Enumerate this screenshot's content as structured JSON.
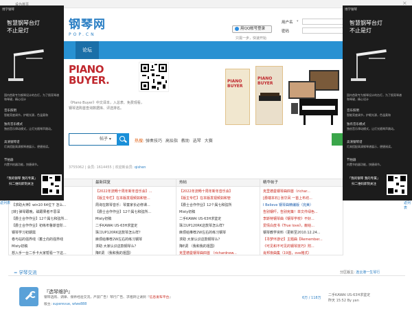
{
  "topbar": {
    "text": "设为首页"
  },
  "logo": {
    "main": "钢琴网",
    "domain": "POP.CN"
  },
  "login": {
    "qq_button": "用QQ帐号登录",
    "hint": "只需一步，快速开始",
    "user_label": "用户名",
    "pass_label": "密码"
  },
  "nav": {
    "active": "论坛"
  },
  "banner": {
    "logo_line1": "PIANO",
    "logo_line2": "BUYER.",
    "book1": "PIANO BUYER",
    "book2": "PIANO BUYER",
    "desc": "《Piano Buyer》中文译本，入总表、免费观看，",
    "desc2": "钢琴选购首查询数据库、评选排名。"
  },
  "search": {
    "category": "帖子",
    "hot_label": "热搜:",
    "hot_items": [
      "弹奏技巧",
      "高抬指",
      "教助",
      "选琴",
      "大赛"
    ]
  },
  "stats": {
    "text": "3755062",
    "label_member": "会员:",
    "members": "1614455",
    "label_new": "欢迎新会员:",
    "new_member": "qishen"
  },
  "table": {
    "cols": [
      {
        "title": "",
        "items": [
          {
            "t": "...乐律... ",
            "c": ""
          },
          {
            "t": "面大/个自选定机额钢琴教... ",
            "c": "r"
          },
          {
            "t": "【求助大神】win10 64位下 怎么...",
            "c": ""
          },
          {
            "t": "[转] 弹琴跟晚，磁跟果者不思深",
            "c": ""
          },
          {
            "t": "【爵士合作作业】12个属七和弦所...",
            "c": ""
          },
          {
            "t": "【爵士合作作业】初练布鲁斯音阶...",
            "c": ""
          },
          {
            "t": "钢琴学习初期需",
            "c": ""
          },
          {
            "t": "卷与站的强界线（蓄士向的强界线",
            "c": ""
          },
          {
            "t": "Misty初稿",
            "c": ""
          },
          {
            "t": "想入手一台二手卡大家帮看一下这...",
            "c": ""
          }
        ]
      },
      {
        "title": "最新回复",
        "items": [
          {
            "t": "【2022年流畅十周年新年音乐会】...",
            "c": "r"
          },
          {
            "t": "【版主专栏】在本版发视频如和管...",
            "c": "r"
          },
          {
            "t": "周询在数琴音乐：琴童家长必修课...",
            "c": ""
          },
          {
            "t": "【爵士合作作业】12个属七和弦所...",
            "c": ""
          },
          {
            "t": "Misty初稿",
            "c": ""
          },
          {
            "t": "二手KAWAI US-63H求鉴定",
            "c": ""
          },
          {
            "t": "珠江UP120RK这款琴怎么样？",
            "c": ""
          },
          {
            "t": "麻烦给推荐2W左右的练习钢琴",
            "c": ""
          },
          {
            "t": "求助 大家认识这款钢琴么？",
            "c": ""
          },
          {
            "t": "降E调 （我和我的祖国）",
            "c": ""
          }
        ]
      },
      {
        "title": "热帖",
        "items": [
          {
            "t": "【2022年流畅十周年新年音乐会】",
            "c": "r"
          },
          {
            "t": "【版主专栏】在本版发视频如和管",
            "c": "r"
          },
          {
            "t": "【爵士合作作业】12个属七和弦所",
            "c": ""
          },
          {
            "t": "Misty初稿",
            "c": ""
          },
          {
            "t": "二手KAWAI US-63H求鉴定",
            "c": ""
          },
          {
            "t": "珠江UP120RK这款琴怎么样？",
            "c": ""
          },
          {
            "t": "麻烦给推荐2W左右的练习钢琴",
            "c": ""
          },
          {
            "t": "求助 大家认识这款钢琴么？",
            "c": ""
          },
          {
            "t": "降E调 （我和我的祖国）",
            "c": ""
          },
          {
            "t": "克里德曼钢琴曲四首 （richardnew...",
            "c": "r"
          }
        ]
      },
      {
        "title": "精华帖子",
        "items": [
          {
            "t": "克里德曼钢琴曲四首（richar...",
            "c": "r"
          },
          {
            "t": "[爵端本石] 张华凤 一首上布坊...",
            "c": "r"
          },
          {
            "t": "I Believe 钢琴曲精编版（完美）",
            "c": "b"
          },
          {
            "t": "告别钢吓，告别宪策！单文件绿色...",
            "c": "r"
          },
          {
            "t": "李斯特钢琴曲《钢琴学校》不好...",
            "c": "r"
          },
          {
            "t": "爱情白皮书《True love》，献给...",
            "c": "r"
          },
          {
            "t": "钢琴教学资料（更新至2010.12.24...",
            "c": ""
          },
          {
            "t": "【寻梦环游记】主题曲【Remember...",
            "c": "r"
          },
          {
            "t": "《可见和不可见的钢琴技巧》附...",
            "c": "r"
          },
          {
            "t": "肖邦夜曲集（19首，ove格式）",
            "c": "r"
          }
        ]
      }
    ]
  },
  "edges": {
    "left": "返列表",
    "right": "返列表"
  },
  "section": {
    "title": "= 学琴交流",
    "mod_label": "分区版主:",
    "mods": "连云港一生琴行"
  },
  "forum": {
    "title": "『选琴维护』",
    "desc": "钢琴选购、调律、保养经验交流，严禁广告！琴行广告、求租转让请到『",
    "desc_link": "信息发布平台",
    "desc_end": "』",
    "mods_label": "版主:",
    "mods": "superevue, wlwe888",
    "count": "6万 / 118万",
    "last1": "二手KAWAI US-63H求鉴定",
    "last2": "昨天 15:52 By yan"
  },
  "ad_left": {
    "header": "博学钢琴",
    "title1": "智慧钢琴台灯",
    "title2": "不止是灯",
    "txt1": "国内首款专为钢琴设计的台灯，为了照亮琴谱和琴键，精心设计",
    "sub1": "音乐照明",
    "txt2": "智能亮度调节，护眼光源，色温柔和",
    "sub2": "独有音乐模式",
    "txt3": "独创音乐律动模式，让灯光随琴声跳动。",
    "sub3": "高清钢琴谱",
    "txt4": "灯具搭配高清钢琴谱展示，便捷阅读。",
    "sub4": "节拍器",
    "txt5": "内置节拍器功能，快捷调节。",
    "qr_text1": "「我的钢琴 我的专属」",
    "qr_text2": "扫二维码即刻关注"
  },
  "ad_right": {
    "header": "博学钢琴",
    "title1": "智慧钢琴台灯",
    "title2": "不止是灯",
    "txt1": "国内首款专为钢琴设计的台灯，为了照亮琴谱和琴键，精心设计",
    "sub1": "音乐照明",
    "txt2": "智能亮度调节，护眼光源，色温柔和",
    "sub2": "独有音乐模式",
    "txt3": "独创音乐律动模式，让灯光随琴声跳动。",
    "sub3": "高清钢琴谱",
    "txt4": "灯具搭配高清钢琴谱展示，便捷阅读。",
    "sub4": "节拍器",
    "txt5": "内置节拍器功能，快捷调节。",
    "qr_text1": "「我的钢琴 我的专属」",
    "qr_text2": "扫二维码即刻关注"
  },
  "close": {
    "label": "×"
  },
  "colors": {
    "brand": "#2891d2",
    "nav_active": "#1a6fa8",
    "red": "#c8271d",
    "ad_bg": "#1c1c1c"
  }
}
